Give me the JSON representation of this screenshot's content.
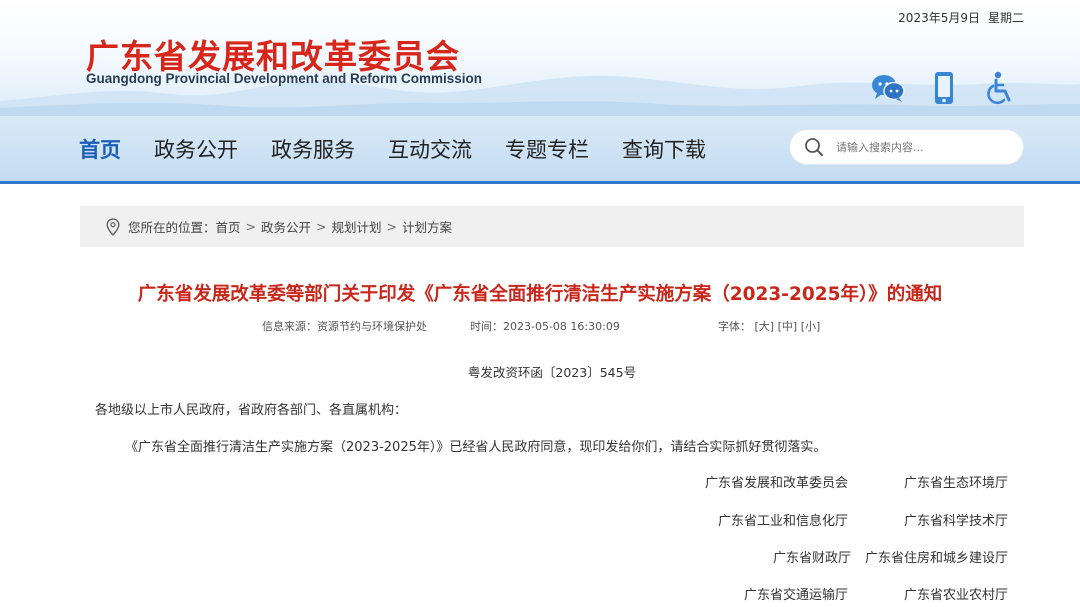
{
  "header": {
    "date": "2023年5月9日",
    "weekday": "星期二",
    "logo_cn": "广东省发展和改革委员会",
    "logo_en": "Guangdong Provincial Development and Reform Commission",
    "tools": [
      {
        "icon": "wechat-icon"
      },
      {
        "icon": "mobile-icon"
      },
      {
        "icon": "accessibility-icon"
      }
    ]
  },
  "nav": {
    "items": [
      {
        "label": "首页",
        "active": true
      },
      {
        "label": "政务公开"
      },
      {
        "label": "政务服务"
      },
      {
        "label": "互动交流"
      },
      {
        "label": "专题专栏"
      },
      {
        "label": "查询下载"
      }
    ],
    "search_placeholder": "请输入搜索内容..."
  },
  "breadcrumb": {
    "prefix": "您所在的位置：",
    "items": [
      "首页",
      "政务公开",
      "规划计划",
      "计划方案"
    ],
    "separator": ">"
  },
  "article": {
    "title": "广东省发展改革委等部门关于印发《广东省全面推行清洁生产实施方案（2023-2025年）》的通知",
    "source": "信息来源：资源节约与环境保护处",
    "time": "时间：2023-05-08 16:30:09",
    "font_label": "字体：",
    "font_sizes": [
      "[大]",
      "[中]",
      "[小]"
    ],
    "doc_no": "粤发改资环函〔2023〕545号",
    "salutation": "各地级以上市人民政府，省政府各部门、各直属机构：",
    "body": "《广东省全面推行清洁生产实施方案（2023-2025年）》已经省人民政府同意，现印发给你们，请结合实际抓好贯彻落实。",
    "signatories": [
      [
        "广东省发展和改革委员会",
        "广东省生态环境厅"
      ],
      [
        "广东省工业和信息化厅",
        "广东省科学技术厅"
      ],
      [
        "广东省财政厅",
        "广东省住房和城乡建设厅"
      ],
      [
        "广东省交通运输厅",
        "广东省农业农村厅"
      ]
    ]
  },
  "colors": {
    "brand_red": "#d7261a",
    "nav_active": "#1b5fb8",
    "nav_border": "#2f7ad0",
    "title_red": "#c8281c"
  }
}
